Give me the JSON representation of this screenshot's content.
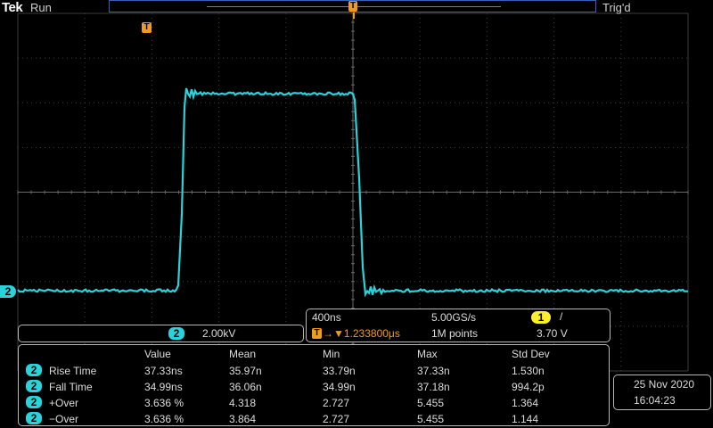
{
  "header": {
    "brand": "Tek",
    "acq_state": "Run",
    "trigger_status": "Trig'd"
  },
  "markers": {
    "trigger_marker": "T",
    "trigger_position_marker": "T",
    "channel_marker": "2"
  },
  "channel": {
    "number": "2",
    "scale": "2.00kV",
    "color": "#2ad2dc"
  },
  "horizontal": {
    "time_per_div": "400ns",
    "sample_rate": "5.00GS/s",
    "record_length": "1M points",
    "trigger_icon": "T",
    "trigger_delay": "→▼1.233800μs",
    "trigger_source": "1",
    "trigger_slope": "/",
    "trigger_level": "3.70 V",
    "trigger_color": "#ffee2e",
    "accent": "#f29a1d"
  },
  "measurements": {
    "headers": [
      "Value",
      "Mean",
      "Min",
      "Max",
      "Std Dev"
    ],
    "rows": [
      {
        "ch": "2",
        "name": "Rise Time",
        "value": "37.33ns",
        "mean": "35.97n",
        "min": "33.79n",
        "max": "37.33n",
        "std": "1.530n"
      },
      {
        "ch": "2",
        "name": "Fall Time",
        "value": "34.99ns",
        "mean": "36.06n",
        "min": "34.99n",
        "max": "37.18n",
        "std": "994.2p"
      },
      {
        "ch": "2",
        "name": "+Over",
        "value": "3.636 %",
        "mean": "4.318",
        "min": "2.727",
        "max": "5.455",
        "std": "1.364"
      },
      {
        "ch": "2",
        "name": "−Over",
        "value": "3.636 %",
        "mean": "3.864",
        "min": "2.727",
        "max": "5.455",
        "std": "1.144"
      }
    ]
  },
  "datetime": {
    "date": "25 Nov 2020",
    "time": "16:04:23"
  }
}
